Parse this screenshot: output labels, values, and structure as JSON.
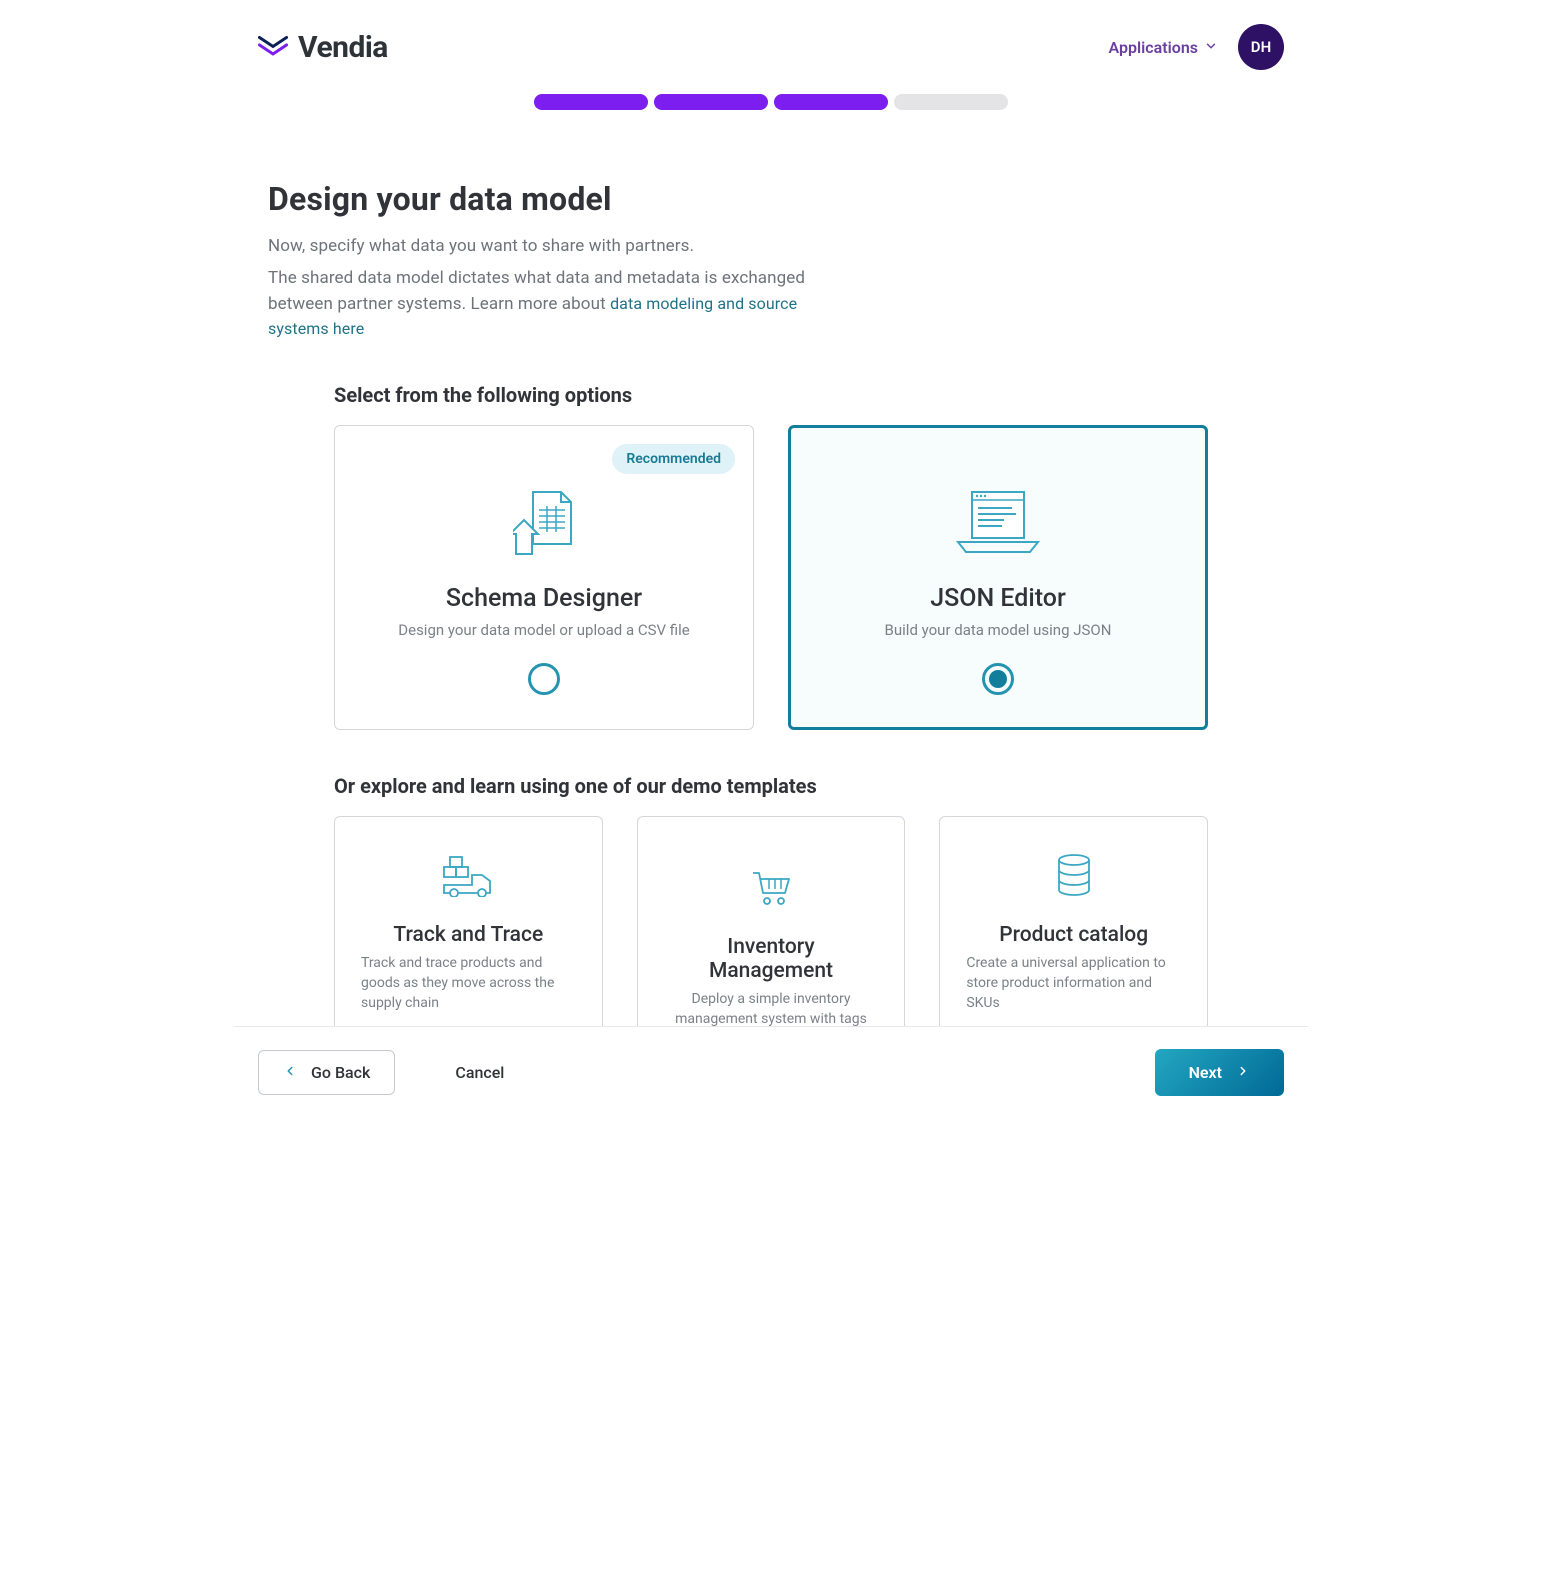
{
  "header": {
    "brand": "Vendia",
    "nav_label": "Applications",
    "avatar_initials": "DH"
  },
  "progress": {
    "total": 4,
    "completed": 3
  },
  "page": {
    "title": "Design your data model",
    "subtitle1": "Now, specify what data you want to share with partners.",
    "subtitle2_prefix": "The shared data model dictates what data and metadata is exchanged between partner systems. Learn more about ",
    "link_text": "data modeling and source systems here"
  },
  "options": {
    "section_title": "Select from the following options",
    "cards": [
      {
        "title": "Schema Designer",
        "desc": "Design your data model or upload a CSV file",
        "badge": "Recommended",
        "selected": false
      },
      {
        "title": "JSON Editor",
        "desc": "Build your data model using JSON",
        "selected": true
      }
    ]
  },
  "templates": {
    "section_title": "Or explore and learn using one of our demo templates",
    "cards": [
      {
        "title": "Track and Trace",
        "desc": "Track and trace products and goods as they move across the supply chain"
      },
      {
        "title": "Inventory Management",
        "desc": "Deploy a simple inventory management system with tags"
      },
      {
        "title": "Product catalog",
        "desc": "Create a universal application to store product information and SKUs"
      }
    ]
  },
  "footer": {
    "go_back": "Go Back",
    "cancel": "Cancel",
    "next": "Next"
  }
}
